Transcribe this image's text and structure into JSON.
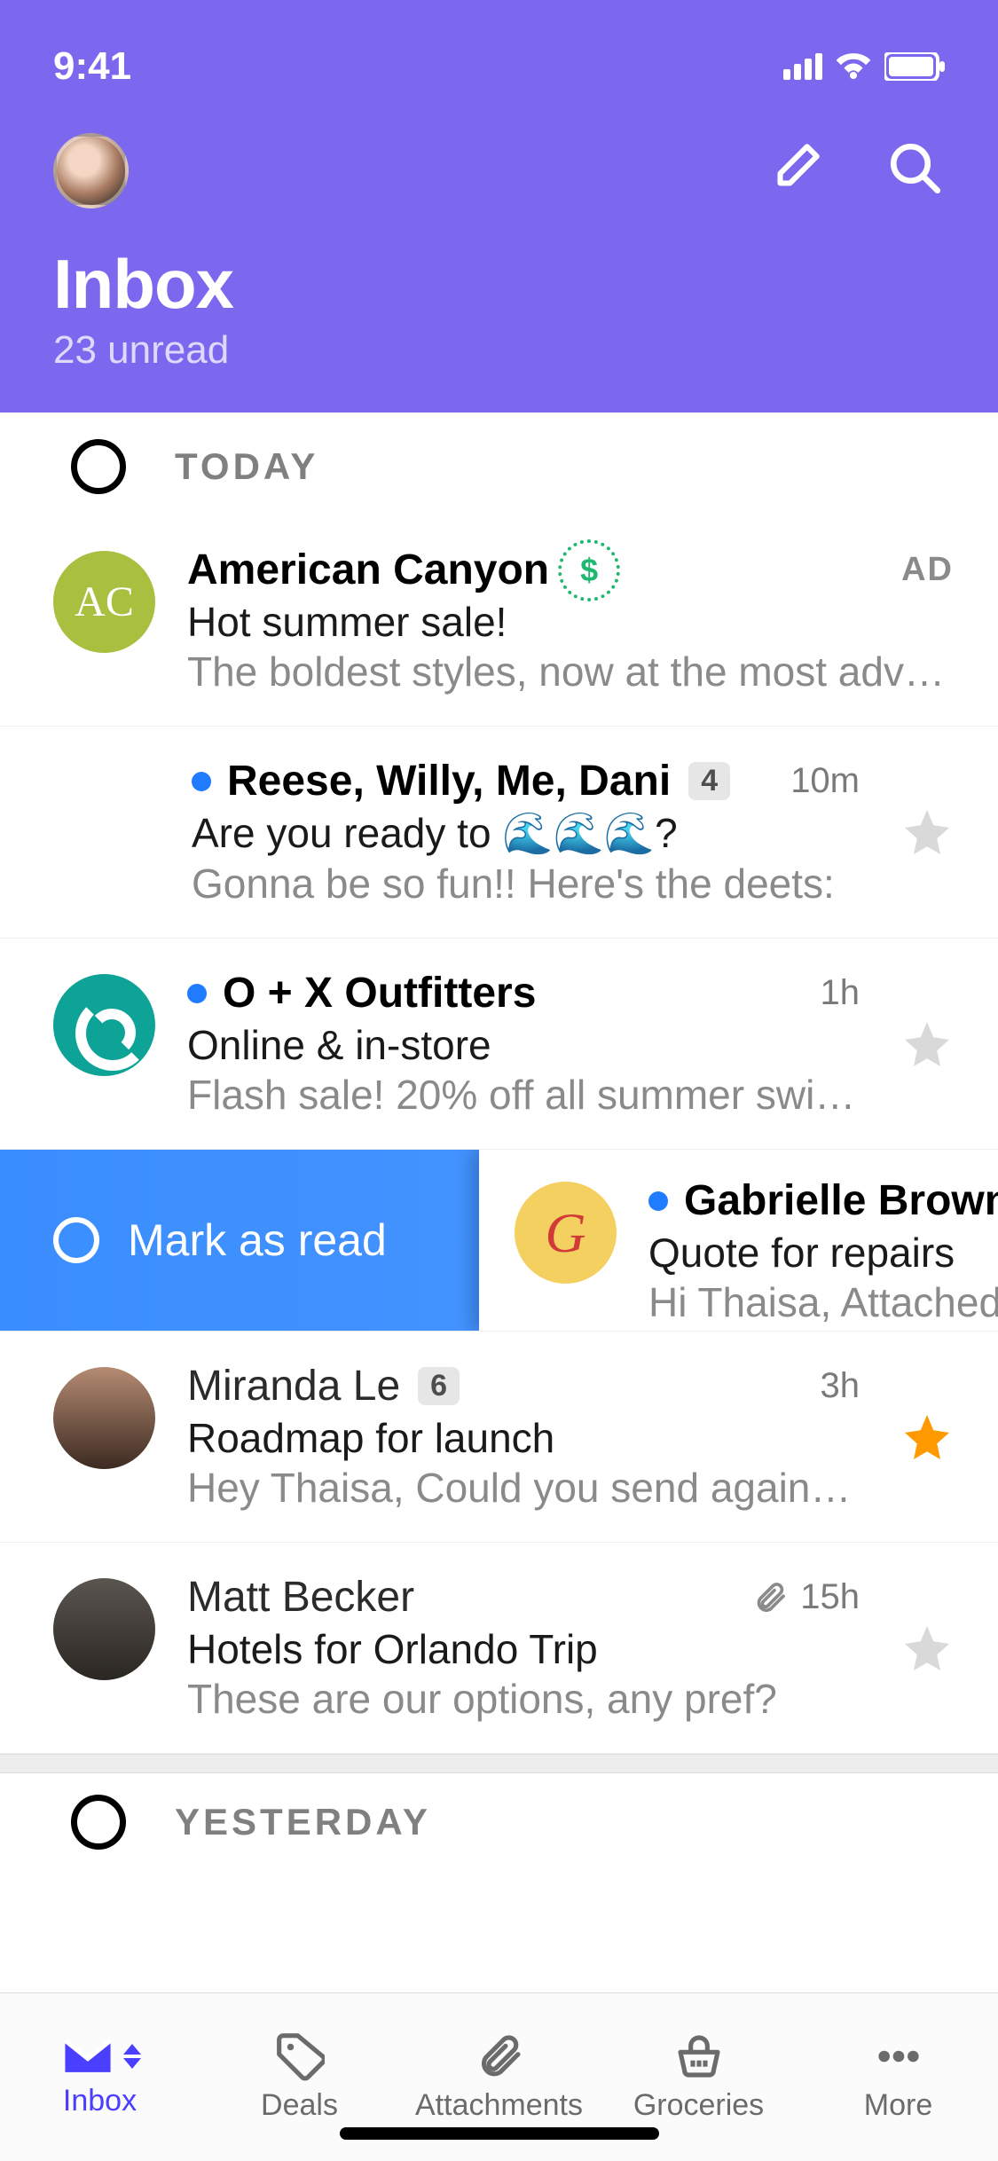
{
  "status": {
    "time": "9:41"
  },
  "header": {
    "title": "Inbox",
    "subtitle": "23 unread"
  },
  "sections": {
    "today": "TODAY",
    "yesterday": "YESTERDAY"
  },
  "emails": [
    {
      "avatar_initials": "AC",
      "sender": "American Canyon",
      "ad_label": "AD",
      "subject": "Hot summer sale!",
      "preview": "The boldest styles, now at the most adven…"
    },
    {
      "unread": true,
      "sender": "Reese, Willy, Me, Dani",
      "count": "4",
      "time": "10m",
      "subject": "Are you ready to  🌊🌊🌊?",
      "preview": "Gonna be so fun!! Here's the deets:"
    },
    {
      "unread": true,
      "sender": "O + X Outfitters",
      "time": "1h",
      "subject": "Online & in-store",
      "preview": "Flash sale! 20% off all summer swim…"
    },
    {
      "swipe_action": "Mark as read",
      "unread": true,
      "sender": "Gabrielle Brown",
      "subject": "Quote for repairs",
      "preview": "Hi Thaisa, Attached"
    },
    {
      "sender": "Miranda Le",
      "count": "6",
      "time": "3h",
      "subject": "Roadmap for launch",
      "preview": "Hey Thaisa, Could you send again? I …",
      "starred": true
    },
    {
      "sender": "Matt Becker",
      "time": "15h",
      "has_attachment": true,
      "subject": "Hotels for Orlando Trip",
      "preview": "These are our options, any pref?"
    }
  ],
  "tabs": {
    "inbox": "Inbox",
    "deals": "Deals",
    "attachments": "Attachments",
    "groceries": "Groceries",
    "more": "More"
  }
}
